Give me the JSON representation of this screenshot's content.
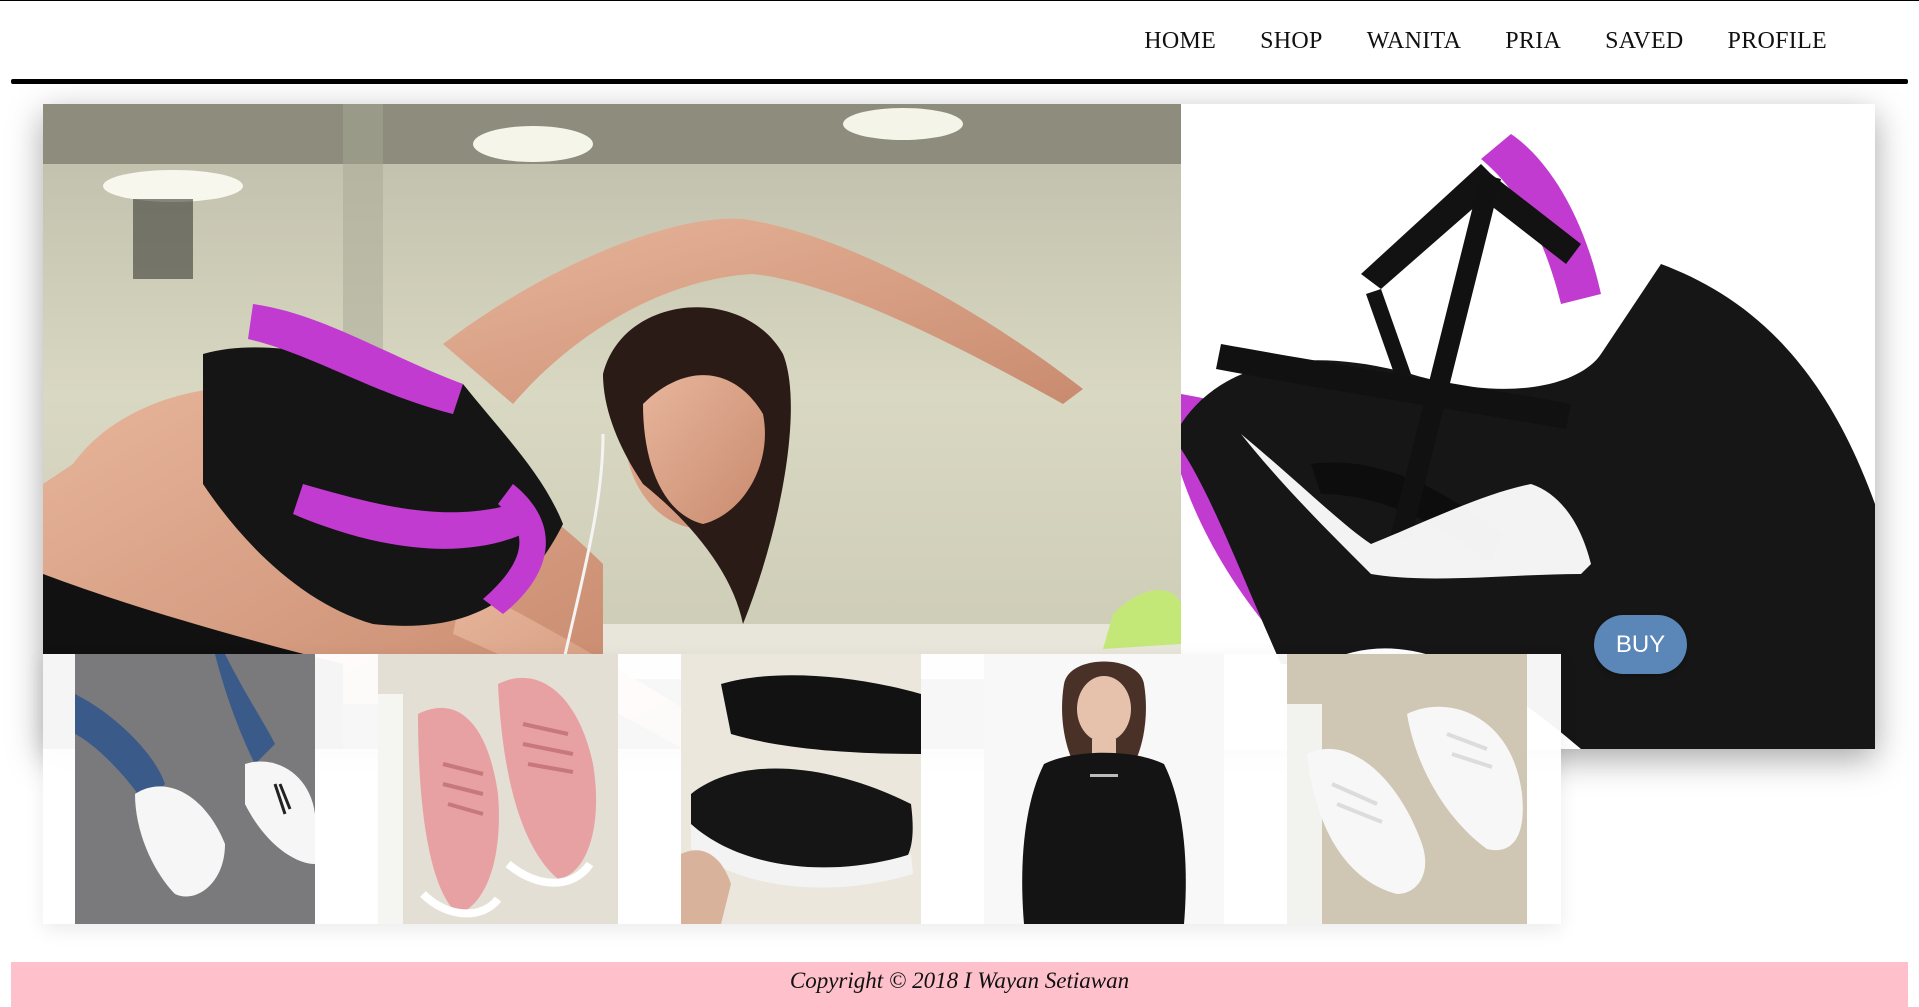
{
  "nav": {
    "items": [
      {
        "label": "HOME"
      },
      {
        "label": "SHOP"
      },
      {
        "label": "WANITA"
      },
      {
        "label": "PRIA"
      },
      {
        "label": "SAVED"
      },
      {
        "label": "PROFILE"
      }
    ]
  },
  "hero": {
    "buy_label": "BUY"
  },
  "thumbnails": [
    {
      "subject": "white-sneakers-on-feet"
    },
    {
      "subject": "pink-sneakers"
    },
    {
      "subject": "black-sneakers"
    },
    {
      "subject": "black-long-sleeve-sport-top"
    },
    {
      "subject": "white-sneakers"
    }
  ],
  "footer": {
    "copyright": "Copyright © 2018 I Wayan Setiawan"
  },
  "colors": {
    "footer_bg": "#fec0ca",
    "buy_button": "#5b87b8",
    "nav_rule": "#000000",
    "bra_accent": "#c13bd0"
  }
}
